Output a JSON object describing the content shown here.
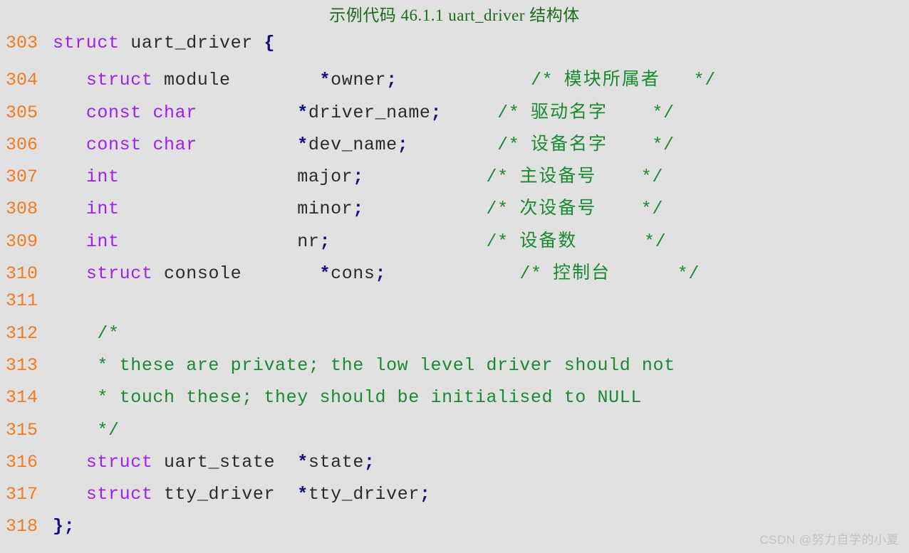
{
  "title": "示例代码 46.1.1 uart_driver 结构体",
  "colors": {
    "background": "#e1e1e1",
    "line_number": "#f47b20",
    "keyword": "#a020f0",
    "identifier": "#2b2b2b",
    "punctuation": "#101080",
    "comment": "#1a8a2e",
    "title": "#1a6b18",
    "watermark": "#c2c2c2"
  },
  "watermark": "CSDN @努力自学的小夏",
  "code": {
    "language": "c",
    "lines": [
      {
        "num": "303",
        "tokens": [
          {
            "t": "struct",
            "c": "kw"
          },
          {
            "t": " ",
            "c": "id"
          },
          {
            "t": "uart_driver",
            "c": "id"
          },
          {
            "t": " ",
            "c": "id"
          },
          {
            "t": "{",
            "c": "brace"
          }
        ]
      },
      {
        "num": "304",
        "tokens": [
          {
            "t": "   ",
            "c": "id"
          },
          {
            "t": "struct",
            "c": "kw"
          },
          {
            "t": " ",
            "c": "id"
          },
          {
            "t": "module",
            "c": "id"
          },
          {
            "t": "        ",
            "c": "id"
          },
          {
            "t": "*",
            "c": "punc"
          },
          {
            "t": "owner",
            "c": "id"
          },
          {
            "t": ";",
            "c": "punc"
          },
          {
            "t": "            ",
            "c": "id"
          },
          {
            "t": "/* ",
            "c": "cmt"
          },
          {
            "t": "模块所属者",
            "c": "cmt-cn"
          },
          {
            "t": "   */",
            "c": "cmt"
          }
        ]
      },
      {
        "num": "305",
        "tokens": [
          {
            "t": "   ",
            "c": "id"
          },
          {
            "t": "const",
            "c": "kw"
          },
          {
            "t": " ",
            "c": "id"
          },
          {
            "t": "char",
            "c": "kw"
          },
          {
            "t": "         ",
            "c": "id"
          },
          {
            "t": "*",
            "c": "punc"
          },
          {
            "t": "driver_name",
            "c": "id"
          },
          {
            "t": ";",
            "c": "punc"
          },
          {
            "t": "     ",
            "c": "id"
          },
          {
            "t": "/* ",
            "c": "cmt"
          },
          {
            "t": "驱动名字",
            "c": "cmt-cn"
          },
          {
            "t": "    */",
            "c": "cmt"
          }
        ]
      },
      {
        "num": "306",
        "tokens": [
          {
            "t": "   ",
            "c": "id"
          },
          {
            "t": "const",
            "c": "kw"
          },
          {
            "t": " ",
            "c": "id"
          },
          {
            "t": "char",
            "c": "kw"
          },
          {
            "t": "         ",
            "c": "id"
          },
          {
            "t": "*",
            "c": "punc"
          },
          {
            "t": "dev_name",
            "c": "id"
          },
          {
            "t": ";",
            "c": "punc"
          },
          {
            "t": "        ",
            "c": "id"
          },
          {
            "t": "/* ",
            "c": "cmt"
          },
          {
            "t": "设备名字",
            "c": "cmt-cn"
          },
          {
            "t": "    */",
            "c": "cmt"
          }
        ]
      },
      {
        "num": "307",
        "tokens": [
          {
            "t": "   ",
            "c": "id"
          },
          {
            "t": "int",
            "c": "kw"
          },
          {
            "t": "                ",
            "c": "id"
          },
          {
            "t": "major",
            "c": "id"
          },
          {
            "t": ";",
            "c": "punc"
          },
          {
            "t": "           ",
            "c": "id"
          },
          {
            "t": "/* ",
            "c": "cmt"
          },
          {
            "t": "主设备号",
            "c": "cmt-cn"
          },
          {
            "t": "    */",
            "c": "cmt"
          }
        ]
      },
      {
        "num": "308",
        "tokens": [
          {
            "t": "   ",
            "c": "id"
          },
          {
            "t": "int",
            "c": "kw"
          },
          {
            "t": "                ",
            "c": "id"
          },
          {
            "t": "minor",
            "c": "id"
          },
          {
            "t": ";",
            "c": "punc"
          },
          {
            "t": "           ",
            "c": "id"
          },
          {
            "t": "/* ",
            "c": "cmt"
          },
          {
            "t": "次设备号",
            "c": "cmt-cn"
          },
          {
            "t": "    */",
            "c": "cmt"
          }
        ]
      },
      {
        "num": "309",
        "tokens": [
          {
            "t": "   ",
            "c": "id"
          },
          {
            "t": "int",
            "c": "kw"
          },
          {
            "t": "                ",
            "c": "id"
          },
          {
            "t": "nr",
            "c": "id"
          },
          {
            "t": ";",
            "c": "punc"
          },
          {
            "t": "              ",
            "c": "id"
          },
          {
            "t": "/* ",
            "c": "cmt"
          },
          {
            "t": "设备数",
            "c": "cmt-cn"
          },
          {
            "t": "      */",
            "c": "cmt"
          }
        ]
      },
      {
        "num": "310",
        "tokens": [
          {
            "t": "   ",
            "c": "id"
          },
          {
            "t": "struct",
            "c": "kw"
          },
          {
            "t": " ",
            "c": "id"
          },
          {
            "t": "console",
            "c": "id"
          },
          {
            "t": "       ",
            "c": "id"
          },
          {
            "t": "*",
            "c": "punc"
          },
          {
            "t": "cons",
            "c": "id"
          },
          {
            "t": ";",
            "c": "punc"
          },
          {
            "t": "            ",
            "c": "id"
          },
          {
            "t": "/* ",
            "c": "cmt"
          },
          {
            "t": "控制台",
            "c": "cmt-cn"
          },
          {
            "t": "      */",
            "c": "cmt"
          }
        ]
      },
      {
        "num": "311",
        "tokens": []
      },
      {
        "num": "312",
        "tokens": [
          {
            "t": "    /*",
            "c": "cmt"
          }
        ]
      },
      {
        "num": "313",
        "tokens": [
          {
            "t": "    * these are private; the low level driver should not",
            "c": "cmt"
          }
        ]
      },
      {
        "num": "314",
        "tokens": [
          {
            "t": "    * touch these; they should be initialised to NULL",
            "c": "cmt"
          }
        ]
      },
      {
        "num": "315",
        "tokens": [
          {
            "t": "    */",
            "c": "cmt"
          }
        ]
      },
      {
        "num": "316",
        "tokens": [
          {
            "t": "   ",
            "c": "id"
          },
          {
            "t": "struct",
            "c": "kw"
          },
          {
            "t": " ",
            "c": "id"
          },
          {
            "t": "uart_state",
            "c": "id"
          },
          {
            "t": "  ",
            "c": "id"
          },
          {
            "t": "*",
            "c": "punc"
          },
          {
            "t": "state",
            "c": "id"
          },
          {
            "t": ";",
            "c": "punc"
          }
        ]
      },
      {
        "num": "317",
        "tokens": [
          {
            "t": "   ",
            "c": "id"
          },
          {
            "t": "struct",
            "c": "kw"
          },
          {
            "t": " ",
            "c": "id"
          },
          {
            "t": "tty_driver",
            "c": "id"
          },
          {
            "t": "  ",
            "c": "id"
          },
          {
            "t": "*",
            "c": "punc"
          },
          {
            "t": "tty_driver",
            "c": "id"
          },
          {
            "t": ";",
            "c": "punc"
          }
        ]
      },
      {
        "num": "318",
        "tokens": [
          {
            "t": "};",
            "c": "brace"
          }
        ]
      }
    ]
  }
}
